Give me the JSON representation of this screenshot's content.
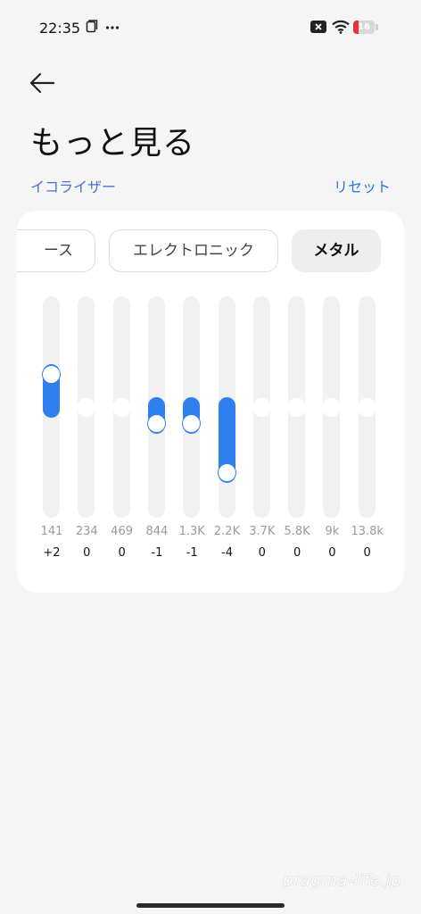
{
  "status_bar": {
    "time": "22:35",
    "battery_level": "16",
    "battery_fraction": 0.16,
    "icons": [
      "copy-icon",
      "more-icon",
      "notification-close-icon",
      "wifi-icon",
      "battery-icon"
    ]
  },
  "header": {
    "title": "もっと見る"
  },
  "equalizer": {
    "label": "イコライザー",
    "reset_label": "リセット",
    "presets": [
      "ース",
      "エレクトロニック",
      "メタル"
    ],
    "selected_preset": "メタル",
    "range": [
      -6,
      6
    ],
    "bands": [
      {
        "freq": "141",
        "gain": "+2",
        "value": 2
      },
      {
        "freq": "234",
        "gain": "0",
        "value": 0
      },
      {
        "freq": "469",
        "gain": "0",
        "value": 0
      },
      {
        "freq": "844",
        "gain": "-1",
        "value": -1
      },
      {
        "freq": "1.3K",
        "gain": "-1",
        "value": -1
      },
      {
        "freq": "2.2K",
        "gain": "-4",
        "value": -4
      },
      {
        "freq": "3.7K",
        "gain": "0",
        "value": 0
      },
      {
        "freq": "5.8K",
        "gain": "0",
        "value": 0
      },
      {
        "freq": "9k",
        "gain": "0",
        "value": 0
      },
      {
        "freq": "13.8k",
        "gain": "0",
        "value": 0
      }
    ]
  },
  "colors": {
    "accent": "#2f7fef",
    "label": "#4a70c8",
    "background": "#f5f5f5"
  },
  "watermark": "pragma-life.jp"
}
